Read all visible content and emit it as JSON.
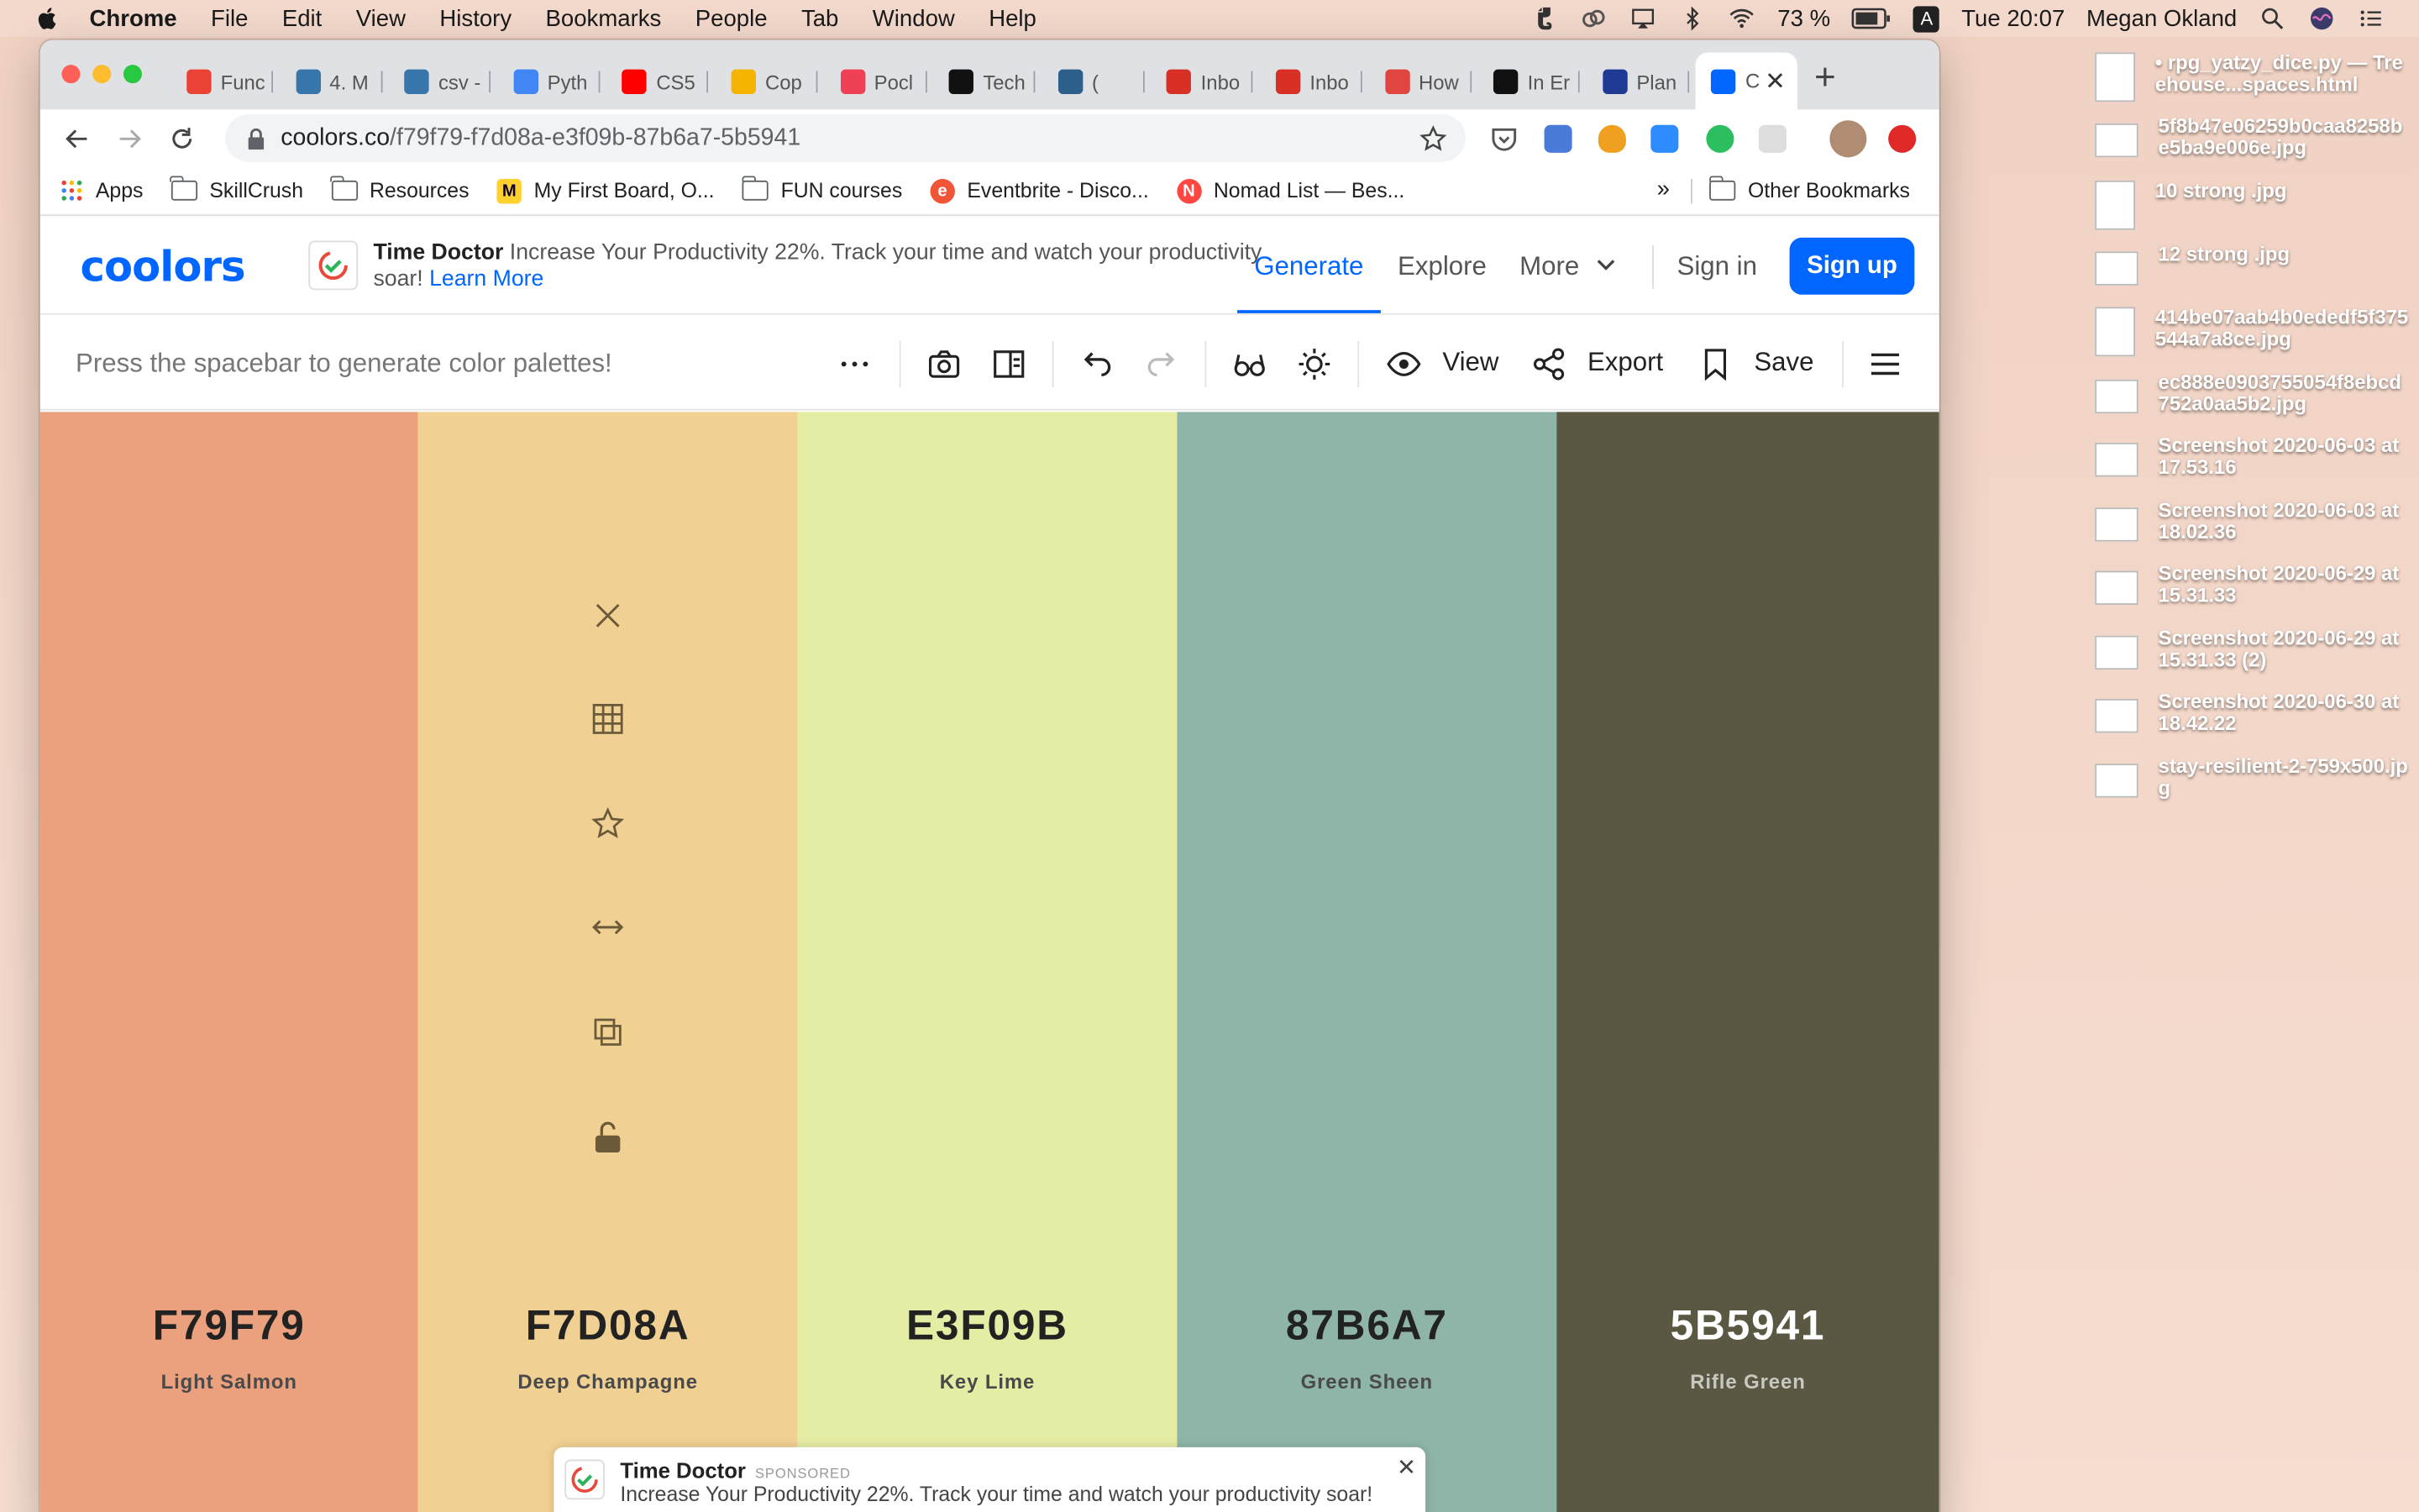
{
  "menubar": {
    "app": "Chrome",
    "items": [
      "File",
      "Edit",
      "View",
      "History",
      "Bookmarks",
      "People",
      "Tab",
      "Window",
      "Help"
    ],
    "battery": "73 %",
    "input_source": "A",
    "clock": "Tue 20:07",
    "user": "Megan Okland"
  },
  "tabs": [
    {
      "label": "Func",
      "icon": "calendar-icon",
      "color": "#ea4335"
    },
    {
      "label": "4. M",
      "icon": "python-icon",
      "color": "#3776ab"
    },
    {
      "label": "csv -",
      "icon": "python-icon",
      "color": "#3776ab"
    },
    {
      "label": "Pyth",
      "icon": "google-icon",
      "color": "#4285f4"
    },
    {
      "label": "CS5",
      "icon": "youtube-icon",
      "color": "#ff0000"
    },
    {
      "label": "Cop",
      "icon": "slides-icon",
      "color": "#f4b400"
    },
    {
      "label": "Pocl",
      "icon": "pocket-icon",
      "color": "#ef4056"
    },
    {
      "label": "Tech",
      "icon": "medium-icon",
      "color": "#111111"
    },
    {
      "label": "(",
      "icon": "docs-icon",
      "color": "#2d5f8b"
    },
    {
      "label": "Inbo",
      "icon": "gmail-icon",
      "color": "#d93025"
    },
    {
      "label": "Inbo",
      "icon": "gmail-icon",
      "color": "#d93025"
    },
    {
      "label": "How",
      "icon": "red-app-icon",
      "color": "#e0463f"
    },
    {
      "label": "In Er",
      "icon": "de-icon",
      "color": "#111111"
    },
    {
      "label": "Plan",
      "icon": "pp-icon",
      "color": "#1f3a93"
    },
    {
      "label": "C",
      "icon": "coolors-icon",
      "color": "#0066ff",
      "active": true
    }
  ],
  "address": {
    "host": "coolors.co",
    "path": "/f79f79-f7d08a-e3f09b-87b6a7-5b5941"
  },
  "bookmarks": [
    {
      "label": "Apps",
      "icon": "apps-grid-icon"
    },
    {
      "label": "SkillCrush",
      "icon": "folder-icon"
    },
    {
      "label": "Resources",
      "icon": "folder-icon"
    },
    {
      "label": "My First Board, O...",
      "icon": "miro-icon"
    },
    {
      "label": "FUN courses",
      "icon": "folder-icon"
    },
    {
      "label": "Eventbrite - Disco...",
      "icon": "eventbrite-icon"
    },
    {
      "label": "Nomad List — Bes...",
      "icon": "nomad-icon"
    }
  ],
  "bookmarks_more": "»",
  "bookmarks_other": "Other Bookmarks",
  "coolors": {
    "logo": "coolors",
    "ad": {
      "brand": "Time Doctor",
      "text": "Increase Your Productivity 22%. Track your time and watch your productivity soar!",
      "link": "Learn More"
    },
    "nav": {
      "generate": "Generate",
      "explore": "Explore",
      "more": "More",
      "signin": "Sign in",
      "signup": "Sign up"
    },
    "toolbar": {
      "hint": "Press the spacebar to generate color palettes!",
      "view": "View",
      "export": "Export",
      "save": "Save"
    },
    "palette": [
      {
        "hex": "F79F79",
        "name": "Light Salmon",
        "color": "#eba07e"
      },
      {
        "hex": "F7D08A",
        "name": "Deep Champagne",
        "color": "#f0d193"
      },
      {
        "hex": "E3F09B",
        "name": "Key Lime",
        "color": "#e5eda5"
      },
      {
        "hex": "87B6A7",
        "name": "Green Sheen",
        "color": "#8fb5a8"
      },
      {
        "hex": "5B5941",
        "name": "Rifle Green",
        "color": "#5a5843"
      }
    ],
    "bottom_ad": {
      "brand": "Time Doctor",
      "sponsored": "SPONSORED",
      "text": "Increase Your Productivity 22%. Track your time and watch your productivity soar!"
    }
  },
  "desktop_files": [
    "• rpg_yatzy_dice.py — Treehouse...spaces.html",
    "5f8b47e06259b0caa8258be5ba9e006e.jpg",
    "10 strong .jpg",
    "12 strong .jpg",
    "414be07aab4b0ededf5f375544a7a8ce.jpg",
    "ec888e0903755054f8ebcd752a0aa5b2.jpg",
    "Screenshot 2020-06-03 at 17.53.16",
    "Screenshot 2020-06-03 at 18.02.36",
    "Screenshot 2020-06-29 at 15.31.33",
    "Screenshot 2020-06-29 at 15.31.33 (2)",
    "Screenshot 2020-06-30 at 18.42.22",
    "stay-resilient-2-759x500.jpg"
  ]
}
